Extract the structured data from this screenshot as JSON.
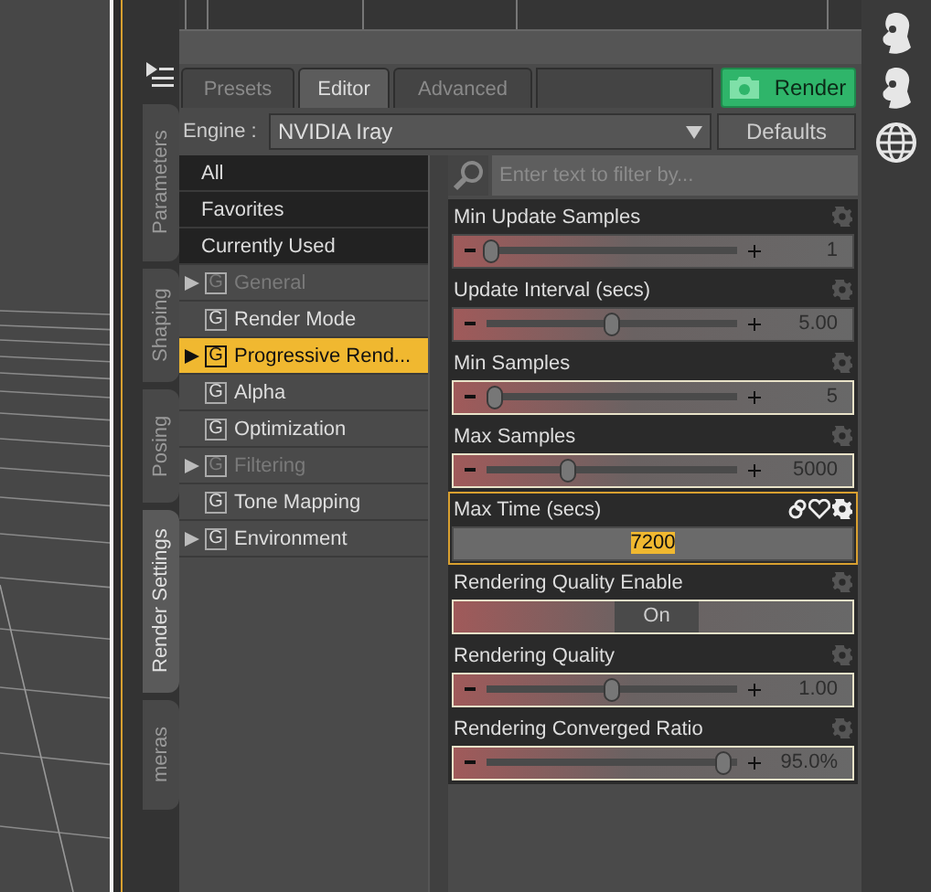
{
  "side_tabs": [
    {
      "label": "Parameters",
      "selected": false
    },
    {
      "label": "Shaping",
      "selected": false
    },
    {
      "label": "Posing",
      "selected": false
    },
    {
      "label": "Render Settings",
      "selected": true
    },
    {
      "label": "meras",
      "selected": false
    }
  ],
  "tabs": [
    {
      "label": "Presets",
      "selected": false,
      "disabled": true
    },
    {
      "label": "Editor",
      "selected": true,
      "disabled": false
    },
    {
      "label": "Advanced",
      "selected": false,
      "disabled": true
    }
  ],
  "render_button": "Render",
  "engine": {
    "label": "Engine :",
    "value": "NVIDIA Iray"
  },
  "defaults_button": "Defaults",
  "groups": [
    {
      "kind": "filter",
      "label": "All",
      "selected": false
    },
    {
      "kind": "filter",
      "label": "Favorites",
      "selected": false
    },
    {
      "kind": "filter",
      "label": "Currently Used",
      "selected": false
    },
    {
      "kind": "group",
      "icon": "G",
      "label": "General",
      "expandable": true,
      "disabled": true,
      "selected": false
    },
    {
      "kind": "group",
      "icon": "G",
      "label": "Render Mode",
      "expandable": false,
      "disabled": false,
      "selected": false
    },
    {
      "kind": "group",
      "icon": "G",
      "label": "Progressive Rend...",
      "expandable": true,
      "disabled": false,
      "selected": true
    },
    {
      "kind": "group",
      "icon": "G",
      "label": "Alpha",
      "expandable": false,
      "disabled": false,
      "selected": false
    },
    {
      "kind": "group",
      "icon": "G",
      "label": "Optimization",
      "expandable": false,
      "disabled": false,
      "selected": false
    },
    {
      "kind": "group",
      "icon": "G",
      "label": "Filtering",
      "expandable": true,
      "disabled": true,
      "selected": false
    },
    {
      "kind": "group",
      "icon": "G",
      "label": "Tone Mapping",
      "expandable": false,
      "disabled": false,
      "selected": false
    },
    {
      "kind": "group",
      "icon": "G",
      "label": "Environment",
      "expandable": true,
      "disabled": false,
      "selected": false
    }
  ],
  "search": {
    "placeholder": "Enter text to filter by..."
  },
  "properties": [
    {
      "kind": "slider",
      "name": "Min Update Samples",
      "level": 0.02,
      "reading": "1",
      "modified": false,
      "selected": false
    },
    {
      "kind": "slider",
      "name": "Update Interval (secs)",
      "level": 0.5,
      "reading": "5.00",
      "modified": false,
      "selected": false
    },
    {
      "kind": "slider",
      "name": "Min Samples",
      "level": 0.04,
      "reading": "5",
      "modified": true,
      "selected": false
    },
    {
      "kind": "slider",
      "name": "Max Samples",
      "level": 0.33,
      "reading": "5000",
      "modified": true,
      "selected": false
    },
    {
      "kind": "number",
      "name": "Max Time (secs)",
      "value": "7200",
      "modified": false,
      "selected": true
    },
    {
      "kind": "toggle",
      "name": "Rendering Quality Enable",
      "value": "On",
      "modified": true,
      "selected": false
    },
    {
      "kind": "slider",
      "name": "Rendering Quality",
      "level": 0.5,
      "reading": "1.00",
      "modified": true,
      "selected": false
    },
    {
      "kind": "slider",
      "name": "Rendering Converged Ratio",
      "level": 0.95,
      "reading": "95.0%",
      "modified": true,
      "selected": false
    }
  ]
}
